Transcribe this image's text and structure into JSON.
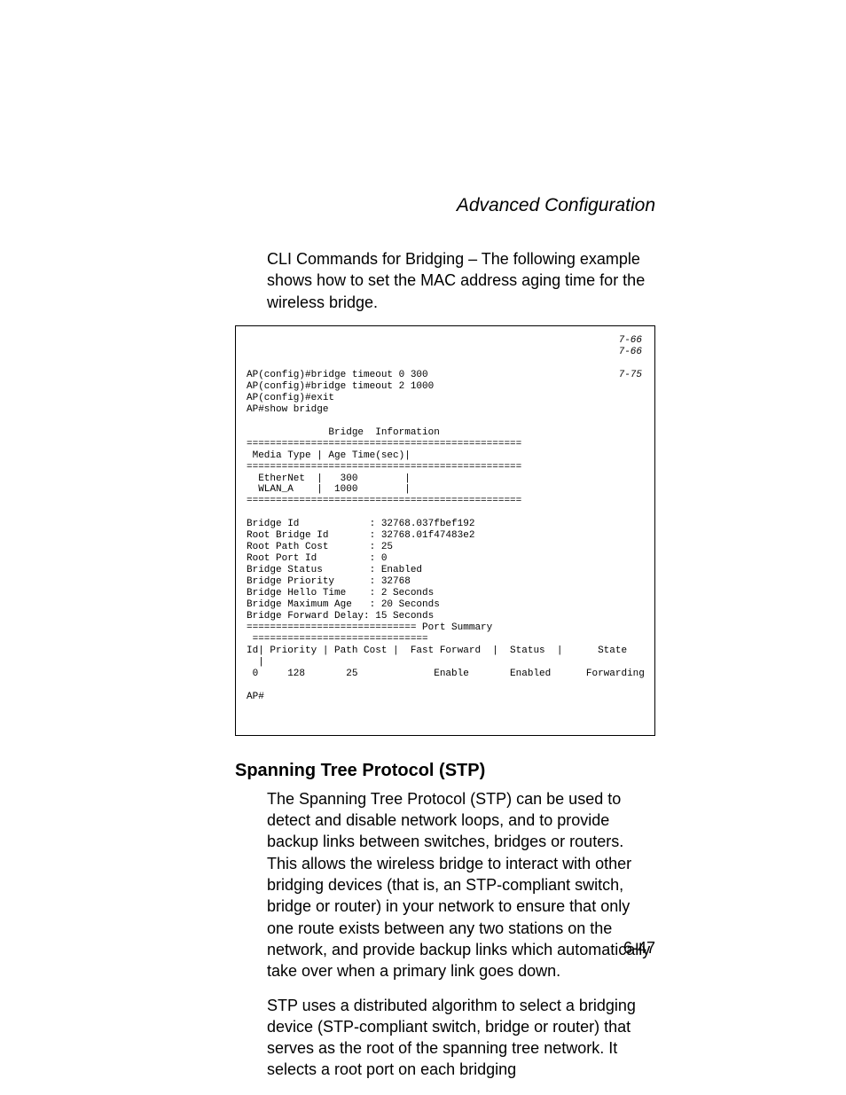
{
  "header": {
    "title": "Advanced Configuration"
  },
  "intro": {
    "paragraph": "CLI Commands for Bridging – The following example shows how to set the MAC address aging time for the wireless bridge."
  },
  "code": {
    "refs": "7-66\n7-66\n\n7-75",
    "body": "AP(config)#bridge timeout 0 300\nAP(config)#bridge timeout 2 1000\nAP(config)#exit\nAP#show bridge\n\n              Bridge  Information\n===============================================\n Media Type | Age Time(sec)|\n===============================================\n  EtherNet  |   300        |\n  WLAN_A    |  1000        |\n===============================================\n\nBridge Id            : 32768.037fbef192\nRoot Bridge Id       : 32768.01f47483e2\nRoot Path Cost       : 25\nRoot Port Id         : 0\nBridge Status        : Enabled\nBridge Priority      : 32768\nBridge Hello Time    : 2 Seconds\nBridge Maximum Age   : 20 Seconds\nBridge Forward Delay: 15 Seconds\n============================= Port Summary  \n ==============================\nId| Priority | Path Cost |  Fast Forward  |  Status  |      State\n  |\n 0     128       25             Enable       Enabled      Forwarding\n\nAP#"
  },
  "section": {
    "title": "Spanning Tree Protocol (STP)",
    "para1": "The Spanning Tree Protocol (STP) can be used to detect and disable network loops, and to provide backup links between switches, bridges or routers. This allows the wireless bridge to interact with other bridging devices (that is, an STP-compliant switch, bridge or router) in your network to ensure that only one route exists between any two stations on the network, and provide backup links which automatically take over when a primary link goes down.",
    "para2": "STP uses a distributed algorithm to select a bridging device (STP-compliant switch, bridge or router) that serves as the root of the spanning tree network. It selects a root port on each bridging"
  },
  "footer": {
    "page": "6-47"
  }
}
